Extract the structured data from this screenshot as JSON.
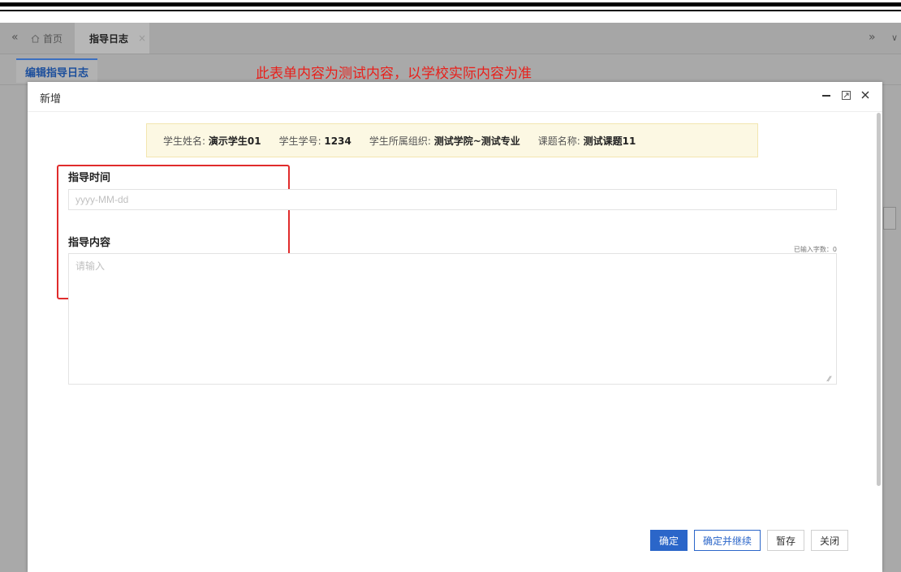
{
  "tabs": {
    "collapse_left_icon": "«",
    "home_label": "首页",
    "active_label": "指导日志",
    "active_close": "×",
    "expand_right_icon": "»",
    "dropdown_icon": "∨"
  },
  "subtab": {
    "label": "编辑指导日志"
  },
  "notice": "此表单内容为测试内容，以学校实际内容为准",
  "modal": {
    "title": "新增",
    "minimize_icon": "—",
    "maximize_icon": "□",
    "close_icon": "×"
  },
  "student": {
    "name_label": "学生姓名: ",
    "name_value": "演示学生01",
    "id_label": "学生学号: ",
    "id_value": "1234",
    "org_label": "学生所属组织: ",
    "org_value": "测试学院~测试专业",
    "topic_label": "课题名称: ",
    "topic_value": "测试课题11"
  },
  "form": {
    "time_label": "指导时间",
    "time_placeholder": "yyyy-MM-dd",
    "time_value": "",
    "content_label": "指导内容",
    "content_placeholder": "请输入",
    "content_value": "",
    "char_count_label": "已输入字数：0"
  },
  "buttons": {
    "confirm": "确定",
    "confirm_continue": "确定并继续",
    "save_draft": "暂存",
    "close": "关闭"
  },
  "colors": {
    "accent": "#2b66c9",
    "notice_red": "#e8201b",
    "highlight_red": "#e02c2c",
    "banner_bg": "#fcf8e3"
  }
}
